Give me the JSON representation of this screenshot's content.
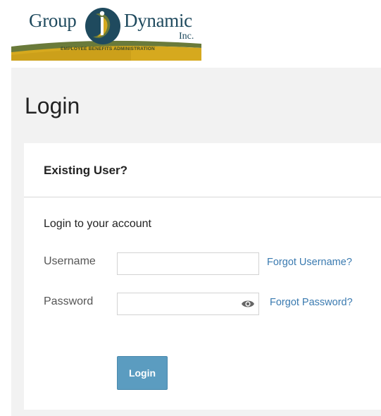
{
  "logo": {
    "word_left": "Group",
    "word_right": "Dynamic",
    "suffix": "Inc.",
    "tagline": "EMPLOYEE BENEFITS ADMINISTRATION"
  },
  "page": {
    "title": "Login"
  },
  "card": {
    "header_title": "Existing User?",
    "subtitle": "Login to your account",
    "username": {
      "label": "Username",
      "value": "",
      "placeholder": "",
      "forgot_link": "Forgot Username?"
    },
    "password": {
      "label": "Password",
      "value": "",
      "placeholder": "",
      "forgot_link": "Forgot Password?",
      "toggle_icon": "eye-icon"
    },
    "submit_label": "Login"
  },
  "colors": {
    "brand_teal": "#1f4a5e",
    "brand_gold": "#d6a91e",
    "brand_green": "#6a7a3a",
    "link": "#3a7ab0",
    "button": "#5b9cc0",
    "panel_bg": "#f2f2f2"
  }
}
